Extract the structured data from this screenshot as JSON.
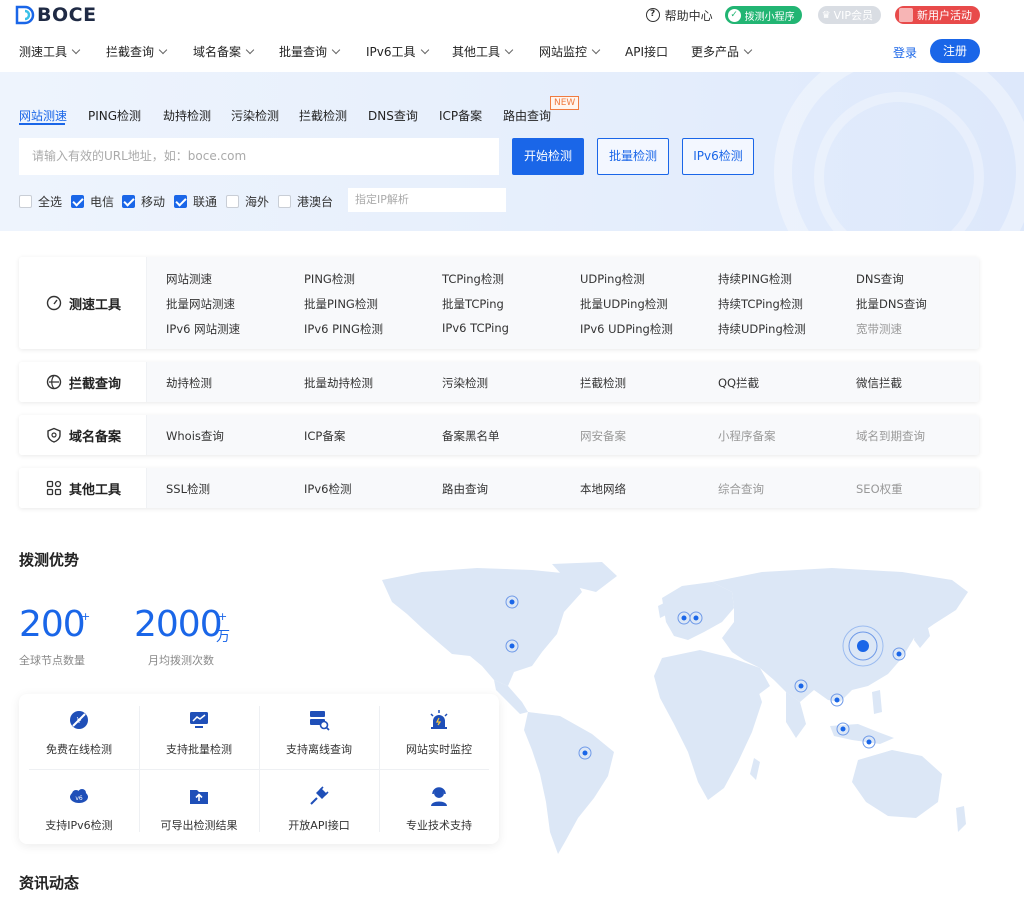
{
  "brand": {
    "name": "BOCE"
  },
  "top": {
    "help": "帮助中心",
    "miniprogram": "拨测小程序",
    "vip": "VIP会员",
    "promo": "新用户活动"
  },
  "nav": {
    "items": [
      "测速工具",
      "拦截查询",
      "域名备案",
      "批量查询",
      "IPv6工具",
      "其他工具",
      "网站监控",
      "API接口",
      "更多产品"
    ],
    "login": "登录",
    "register": "注册"
  },
  "search": {
    "tabs": [
      "网站测速",
      "PING检测",
      "劫持检测",
      "污染检测",
      "拦截检测",
      "DNS查询",
      "ICP备案",
      "路由查询"
    ],
    "new_badge": "NEW",
    "placeholder": "请输入有效的URL地址，如：boce.com",
    "start_button": "开始检测",
    "batch_button": "批量检测",
    "ipv6_button": "IPv6检测",
    "checkboxes": [
      {
        "label": "全选",
        "checked": false
      },
      {
        "label": "电信",
        "checked": true
      },
      {
        "label": "移动",
        "checked": true
      },
      {
        "label": "联通",
        "checked": true
      },
      {
        "label": "海外",
        "checked": false
      },
      {
        "label": "港澳台",
        "checked": false
      }
    ],
    "ip_placeholder": "指定IP解析"
  },
  "tool_groups": [
    {
      "title": "测速工具",
      "icon": "speedometer-icon",
      "rows": [
        [
          "网站测速",
          "PING检测",
          "TCPing检测",
          "UDPing检测",
          "持续PING检测",
          "DNS查询"
        ],
        [
          "批量网站测速",
          "批量PING检测",
          "批量TCPing",
          "批量UDPing检测",
          "持续TCPing检测",
          "批量DNS查询"
        ],
        [
          "IPv6 网站测速",
          "IPv6 PING检测",
          "IPv6 TCPing",
          "IPv6 UDPing检测",
          "持续UDPing检测",
          "宽带测速"
        ]
      ]
    },
    {
      "title": "拦截查询",
      "icon": "globe-shield-icon",
      "rows": [
        [
          "劫持检测",
          "批量劫持检测",
          "污染检测",
          "拦截检测",
          "QQ拦截",
          "微信拦截"
        ]
      ]
    },
    {
      "title": "域名备案",
      "icon": "shield-icon",
      "rows": [
        [
          "Whois查询",
          "ICP备案",
          "备案黑名单",
          "网安备案",
          "小程序备案",
          "域名到期查询"
        ]
      ]
    },
    {
      "title": "其他工具",
      "icon": "grid-icon",
      "rows": [
        [
          "SSL检测",
          "IPv6检测",
          "路由查询",
          "本地网络",
          "综合查询",
          "SEO权重"
        ]
      ]
    }
  ],
  "advantages": {
    "title": "拨测优势",
    "stats": [
      {
        "value": "200",
        "sup": "+",
        "unit": "",
        "label": "全球节点数量"
      },
      {
        "value": "2000",
        "sup": "+",
        "unit": "万",
        "label": "月均拨测次数"
      }
    ],
    "features": [
      {
        "label": "免费在线检测",
        "icon": "free-icon"
      },
      {
        "label": "支持批量检测",
        "icon": "monitor-chart-icon"
      },
      {
        "label": "支持离线查询",
        "icon": "server-search-icon"
      },
      {
        "label": "网站实时监控",
        "icon": "alarm-icon"
      },
      {
        "label": "支持IPv6检测",
        "icon": "cloud-ipv6-icon"
      },
      {
        "label": "可导出检测结果",
        "icon": "folder-export-icon"
      },
      {
        "label": "开放API接口",
        "icon": "plug-icon"
      },
      {
        "label": "专业技术支持",
        "icon": "support-agent-icon"
      }
    ]
  },
  "news": {
    "title": "资讯动态"
  },
  "colors": {
    "primary": "#1a66e8",
    "green": "#22b573",
    "red": "#e84a4a",
    "map": "#dbe7f7"
  }
}
